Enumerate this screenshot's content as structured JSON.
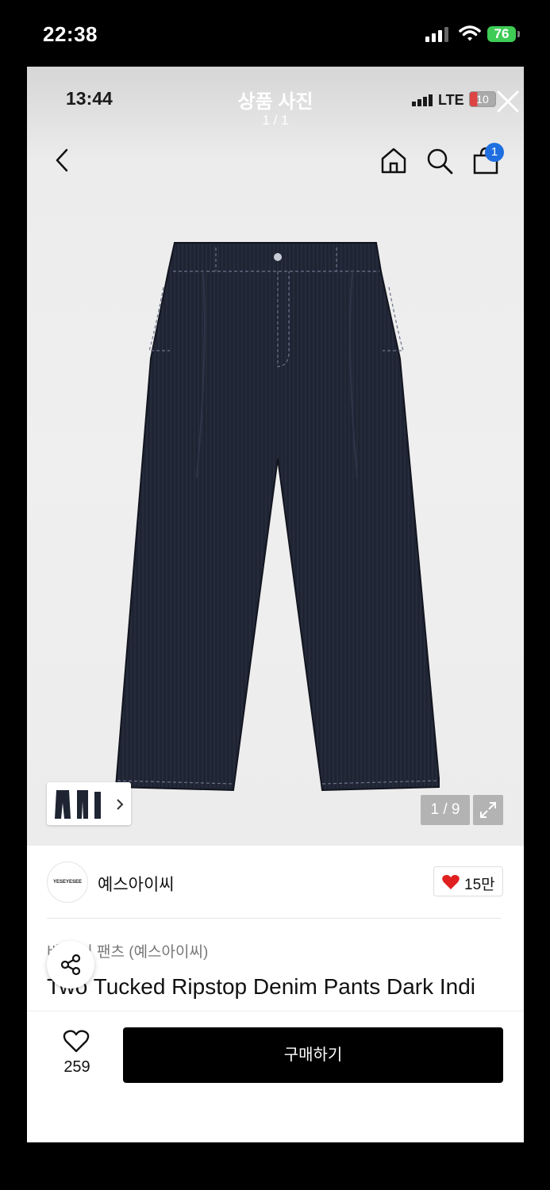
{
  "status_bar": {
    "time": "22:38",
    "battery": "76"
  },
  "inner_status": {
    "time": "13:44",
    "network": "LTE",
    "battery": "10"
  },
  "viewer": {
    "title": "상품 사진",
    "count": "1 / 1"
  },
  "header": {
    "cart_badge": "1"
  },
  "gallery": {
    "page_indicator": "1 / 9"
  },
  "brand": {
    "logo_text": "YESEYESEE",
    "name": "예스아이씨",
    "likes": "15만"
  },
  "product": {
    "category": "바    데님 팬츠 (예스아이씨)",
    "title": "Two Tucked Ripstop Denim Pants Dark Indi"
  },
  "bottom_bar": {
    "wish_count": "259",
    "buy_label": "구매하기"
  },
  "colors": {
    "accent_blue": "#1f6fe0",
    "heart_red": "#e02020",
    "denim": "#1f2433"
  }
}
